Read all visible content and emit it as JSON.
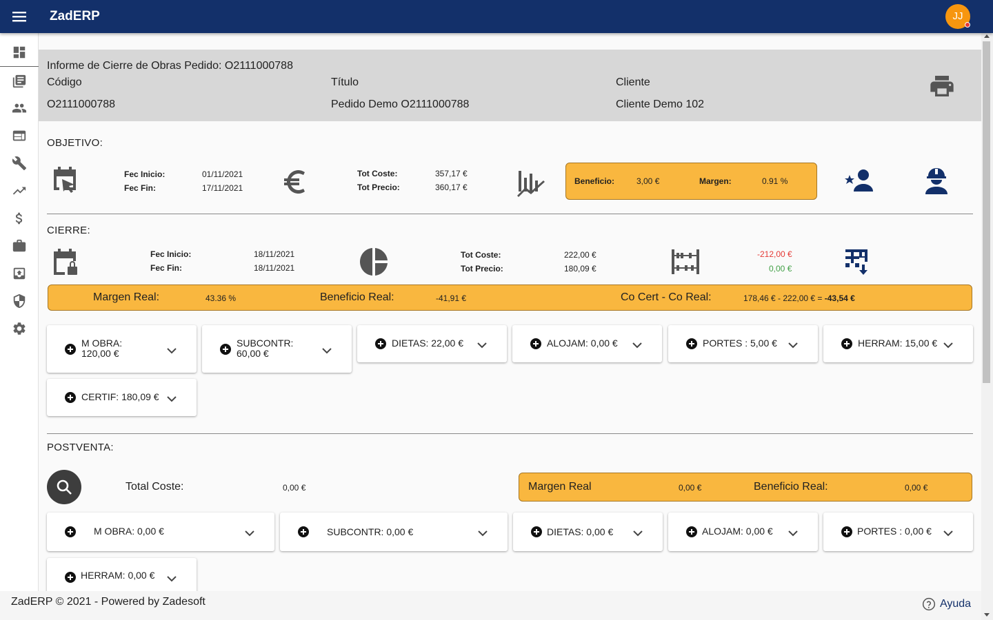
{
  "app": {
    "title": "ZadERP",
    "avatar_initials": "JJ"
  },
  "sidebar": {
    "items": [
      {
        "icon": "dashboard-icon"
      },
      {
        "icon": "library-books-icon"
      },
      {
        "icon": "people-icon"
      },
      {
        "icon": "web-icon"
      },
      {
        "icon": "wrench-icon"
      },
      {
        "icon": "trending-up-icon"
      },
      {
        "icon": "dollar-icon"
      },
      {
        "icon": "briefcase-icon"
      },
      {
        "icon": "archive-icon"
      },
      {
        "icon": "shield-icon"
      },
      {
        "icon": "gear-icon"
      }
    ]
  },
  "header": {
    "title": "Informe de Cierre de Obras Pedido: O2111000788",
    "codigo_label": "Código",
    "codigo_value": "O2111000788",
    "titulo_label": "Título",
    "titulo_value": "Pedido Demo O2111000788",
    "cliente_label": "Cliente",
    "cliente_value": "Cliente Demo 102"
  },
  "objetivo": {
    "title": "OBJETIVO:",
    "fec_inicio_label": "Fec Inicio:",
    "fec_inicio": "01/11/2021",
    "fec_fin_label": "Fec Fin:",
    "fec_fin": "17/11/2021",
    "tot_coste_label": "Tot Coste:",
    "tot_coste": "357,17 €",
    "tot_precio_label": "Tot Precio:",
    "tot_precio": "360,17 €",
    "beneficio_label": "Beneficio:",
    "beneficio": "3,00 €",
    "margen_label": "Margen:",
    "margen": "0.91 %"
  },
  "cierre": {
    "title": "CIERRE:",
    "fec_inicio_label": "Fec Inicio:",
    "fec_inicio": "18/11/2021",
    "fec_fin_label": "Fec Fin:",
    "fec_fin": "18/11/2021",
    "tot_coste_label": "Tot Coste:",
    "tot_coste": "222,00 €",
    "tot_precio_label": "Tot Precio:",
    "tot_precio": "180,09 €",
    "diff_negative": "-212,00 €",
    "diff_positive": "0,00 €",
    "margen_real_label": "Margen Real:",
    "margen_real": "43.36 %",
    "beneficio_real_label": "Beneficio Real:",
    "beneficio_real": "-41,91 €",
    "cocert_label": "Co Cert - Co Real:",
    "cocert_formula": "178,46 € - 222,00 € = ",
    "cocert_result": "-43,54 €",
    "cards": [
      {
        "line1": "M OBRA:",
        "line2": "120,00 €"
      },
      {
        "line1": "SUBCONTR:",
        "line2": "60,00 €"
      },
      {
        "line1": "DIETAS: 22,00 €"
      },
      {
        "line1": "ALOJAM: 0,00 €"
      },
      {
        "line1": "PORTES : 5,00 €"
      },
      {
        "line1": "HERRAM: 15,00 €"
      },
      {
        "line1": "CERTIF: 180,09 €"
      }
    ]
  },
  "postventa": {
    "title": "POSTVENTA:",
    "total_coste_label": "Total Coste:",
    "total_coste": "0,00 €",
    "margen_real_label": "Margen Real",
    "margen_real": "0,00 €",
    "beneficio_real_label": "Beneficio Real:",
    "beneficio_real": "0,00 €",
    "cards": [
      {
        "line1": "M OBRA: 0,00 €"
      },
      {
        "line1": "SUBCONTR: 0,00 €"
      },
      {
        "line1": "DIETAS: 0,00 €"
      },
      {
        "line1": "ALOJAM: 0,00 €"
      },
      {
        "line1": "PORTES : 0,00 €"
      },
      {
        "line1": "HERRAM: 0,00 €"
      }
    ]
  },
  "footer": {
    "text": "ZadERP © 2021 - Powered by Zadesoft",
    "help_label": "Ayuda"
  },
  "colors": {
    "primary": "#13306a",
    "accent_orange": "#f9b73f",
    "avatar": "#f7960f",
    "negative": "#e53935",
    "positive": "#43a047"
  }
}
